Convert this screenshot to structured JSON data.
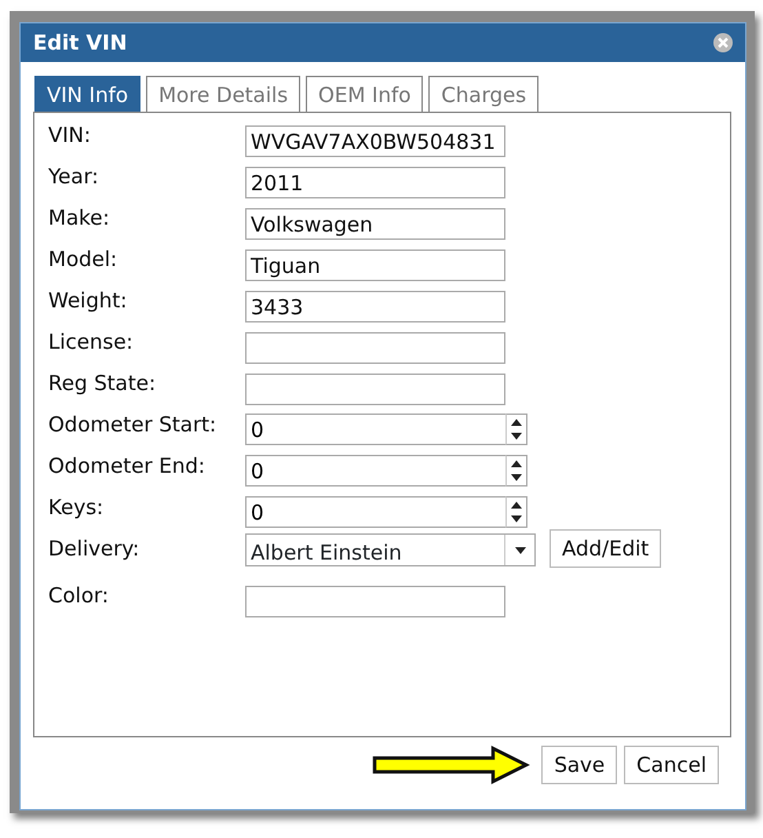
{
  "dialog": {
    "title": "Edit VIN"
  },
  "tabs": [
    {
      "label": "VIN Info",
      "selected": true
    },
    {
      "label": "More Details",
      "selected": false
    },
    {
      "label": "OEM Info",
      "selected": false
    },
    {
      "label": "Charges",
      "selected": false
    }
  ],
  "fields": [
    {
      "label": "VIN:",
      "kind": "text",
      "value": "WVGAV7AX0BW504831"
    },
    {
      "label": "Year:",
      "kind": "text",
      "value": "2011"
    },
    {
      "label": "Make:",
      "kind": "text",
      "value": "Volkswagen"
    },
    {
      "label": "Model:",
      "kind": "text",
      "value": "Tiguan"
    },
    {
      "label": "Weight:",
      "kind": "text",
      "value": "3433"
    },
    {
      "label": "License:",
      "kind": "text"
    },
    {
      "label": "Reg State:",
      "kind": "text"
    },
    {
      "label": "Odometer Start:",
      "kind": "number",
      "value": "0"
    },
    {
      "label": "Odometer End:",
      "kind": "number",
      "value": "0"
    },
    {
      "label": "Keys:",
      "kind": "number",
      "value": "0"
    },
    {
      "label": "Delivery:",
      "kind": "select",
      "value": "Albert Einstein",
      "button": "Add/Edit"
    },
    {
      "label": "Color:",
      "kind": "text"
    }
  ],
  "buttons": [
    "Save",
    "Cancel"
  ]
}
